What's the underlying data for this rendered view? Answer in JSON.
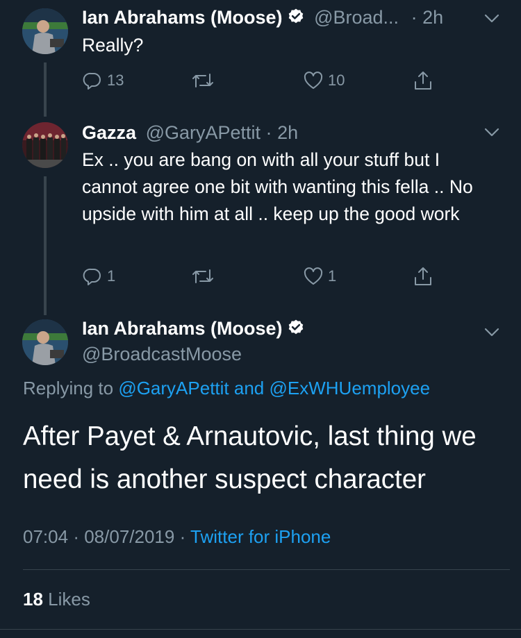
{
  "tweets": [
    {
      "name": "Ian Abrahams (Moose)",
      "handle": "@Broad...",
      "dot": "·",
      "time": "2h",
      "text": "Really?",
      "replies": "13",
      "retweets": "",
      "likes": "10"
    },
    {
      "name": "Gazza",
      "handle": "@GaryAPettit",
      "dot": "·",
      "time": "2h",
      "text": "Ex .. you are bang on with all your stuff but I cannot agree one bit with wanting this fella .. No upside with him at all .. keep up the good work",
      "replies": "1",
      "retweets": "",
      "likes": "1"
    }
  ],
  "main": {
    "name": "Ian Abrahams (Moose)",
    "handle": "@BroadcastMoose",
    "replying_prefix": "Replying to",
    "replying_user1": "@GaryAPettit",
    "replying_and": "and",
    "replying_user2": "@ExWHUemployee",
    "text": "After Payet & Arnautovic, last thing we need is another suspect character",
    "time": "07:04",
    "dot": "·",
    "date": "08/07/2019",
    "dot2": "·",
    "source": "Twitter for iPhone",
    "likes_count": "18",
    "likes_label": "Likes"
  },
  "colors": {
    "background": "#15202b",
    "muted": "#8899a6",
    "link": "#1da1f2",
    "divider": "#38444d"
  }
}
